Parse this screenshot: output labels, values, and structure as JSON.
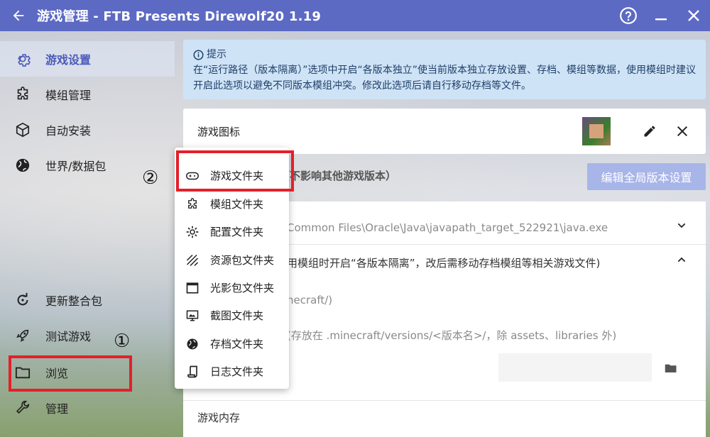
{
  "window": {
    "title": "游戏管理 - FTB Presents Direwolf20 1.19"
  },
  "sidebar": {
    "items": [
      {
        "label": "游戏设置",
        "icon": "gear-icon"
      },
      {
        "label": "模组管理",
        "icon": "puzzle-icon"
      },
      {
        "label": "自动安装",
        "icon": "cube-icon"
      },
      {
        "label": "世界/数据包",
        "icon": "globe-icon"
      },
      {
        "label": "更新整合包",
        "icon": "refresh-icon"
      },
      {
        "label": "测试游戏",
        "icon": "rocket-icon"
      },
      {
        "label": "浏览",
        "icon": "folder-icon"
      },
      {
        "label": "管理",
        "icon": "wrench-icon"
      }
    ]
  },
  "annotations": {
    "badge1": "①",
    "badge2": "②"
  },
  "tip": {
    "title": "提示",
    "text": "在“运行路径（版本隔离）”选项中开启“各版本独立”使当前版本独立存放设置、存档、模组等数据，使用模组时建议开启此选项以避免不同版本模组冲突。修改此选项后请自行移动存档等文件。"
  },
  "game_icon_row": {
    "label": "游戏图标"
  },
  "settings": {
    "section_title": "置（不影响其他游戏版本）",
    "global_button": "编辑全局版本设置",
    "java_path": "Common Files\\Oracle\\Java\\javapath_target_522921\\java.exe",
    "isolation_hint": "用模组时开启“各版本隔离”，改后需移动存档模组等相关游戏文件)",
    "option_default": "necraft/)",
    "option_isolated": "(存放在 .minecraft/versions/<版本名>/，除 assets、libraries 外)",
    "memory_label": "游戏内存"
  },
  "menu": {
    "items": [
      {
        "label": "游戏文件夹",
        "icon": "gamepad-icon"
      },
      {
        "label": "模组文件夹",
        "icon": "puzzle-icon"
      },
      {
        "label": "配置文件夹",
        "icon": "gear-icon"
      },
      {
        "label": "资源包文件夹",
        "icon": "texture-icon"
      },
      {
        "label": "光影包文件夹",
        "icon": "window-icon"
      },
      {
        "label": "截图文件夹",
        "icon": "monitor-icon"
      },
      {
        "label": "存档文件夹",
        "icon": "globe-icon"
      },
      {
        "label": "日志文件夹",
        "icon": "scroll-icon"
      }
    ]
  },
  "colors": {
    "titlebar": "#5c6ac4",
    "accent": "#4a5ab8",
    "highlight": "#e3202a",
    "tip_bg": "#cfe3f6"
  }
}
